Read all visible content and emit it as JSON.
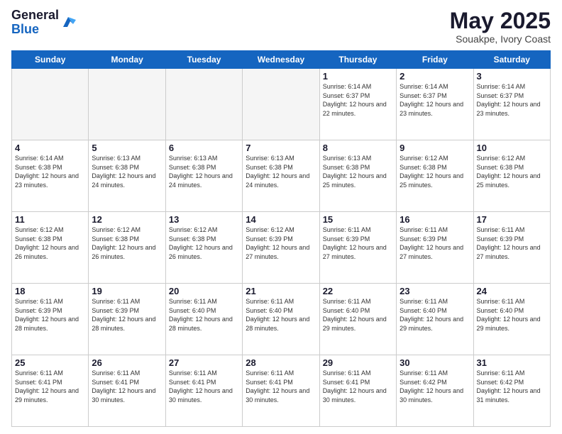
{
  "header": {
    "logo_general": "General",
    "logo_blue": "Blue",
    "month_title": "May 2025",
    "subtitle": "Souakpe, Ivory Coast"
  },
  "days_of_week": [
    "Sunday",
    "Monday",
    "Tuesday",
    "Wednesday",
    "Thursday",
    "Friday",
    "Saturday"
  ],
  "weeks": [
    [
      {
        "day": "",
        "empty": true
      },
      {
        "day": "",
        "empty": true
      },
      {
        "day": "",
        "empty": true
      },
      {
        "day": "",
        "empty": true
      },
      {
        "day": "1",
        "sunrise": "6:14 AM",
        "sunset": "6:37 PM",
        "daylight": "12 hours and 22 minutes."
      },
      {
        "day": "2",
        "sunrise": "6:14 AM",
        "sunset": "6:37 PM",
        "daylight": "12 hours and 23 minutes."
      },
      {
        "day": "3",
        "sunrise": "6:14 AM",
        "sunset": "6:37 PM",
        "daylight": "12 hours and 23 minutes."
      }
    ],
    [
      {
        "day": "4",
        "sunrise": "6:14 AM",
        "sunset": "6:38 PM",
        "daylight": "12 hours and 23 minutes."
      },
      {
        "day": "5",
        "sunrise": "6:13 AM",
        "sunset": "6:38 PM",
        "daylight": "12 hours and 24 minutes."
      },
      {
        "day": "6",
        "sunrise": "6:13 AM",
        "sunset": "6:38 PM",
        "daylight": "12 hours and 24 minutes."
      },
      {
        "day": "7",
        "sunrise": "6:13 AM",
        "sunset": "6:38 PM",
        "daylight": "12 hours and 24 minutes."
      },
      {
        "day": "8",
        "sunrise": "6:13 AM",
        "sunset": "6:38 PM",
        "daylight": "12 hours and 25 minutes."
      },
      {
        "day": "9",
        "sunrise": "6:12 AM",
        "sunset": "6:38 PM",
        "daylight": "12 hours and 25 minutes."
      },
      {
        "day": "10",
        "sunrise": "6:12 AM",
        "sunset": "6:38 PM",
        "daylight": "12 hours and 25 minutes."
      }
    ],
    [
      {
        "day": "11",
        "sunrise": "6:12 AM",
        "sunset": "6:38 PM",
        "daylight": "12 hours and 26 minutes."
      },
      {
        "day": "12",
        "sunrise": "6:12 AM",
        "sunset": "6:38 PM",
        "daylight": "12 hours and 26 minutes."
      },
      {
        "day": "13",
        "sunrise": "6:12 AM",
        "sunset": "6:38 PM",
        "daylight": "12 hours and 26 minutes."
      },
      {
        "day": "14",
        "sunrise": "6:12 AM",
        "sunset": "6:39 PM",
        "daylight": "12 hours and 27 minutes."
      },
      {
        "day": "15",
        "sunrise": "6:11 AM",
        "sunset": "6:39 PM",
        "daylight": "12 hours and 27 minutes."
      },
      {
        "day": "16",
        "sunrise": "6:11 AM",
        "sunset": "6:39 PM",
        "daylight": "12 hours and 27 minutes."
      },
      {
        "day": "17",
        "sunrise": "6:11 AM",
        "sunset": "6:39 PM",
        "daylight": "12 hours and 27 minutes."
      }
    ],
    [
      {
        "day": "18",
        "sunrise": "6:11 AM",
        "sunset": "6:39 PM",
        "daylight": "12 hours and 28 minutes."
      },
      {
        "day": "19",
        "sunrise": "6:11 AM",
        "sunset": "6:39 PM",
        "daylight": "12 hours and 28 minutes."
      },
      {
        "day": "20",
        "sunrise": "6:11 AM",
        "sunset": "6:40 PM",
        "daylight": "12 hours and 28 minutes."
      },
      {
        "day": "21",
        "sunrise": "6:11 AM",
        "sunset": "6:40 PM",
        "daylight": "12 hours and 28 minutes."
      },
      {
        "day": "22",
        "sunrise": "6:11 AM",
        "sunset": "6:40 PM",
        "daylight": "12 hours and 29 minutes."
      },
      {
        "day": "23",
        "sunrise": "6:11 AM",
        "sunset": "6:40 PM",
        "daylight": "12 hours and 29 minutes."
      },
      {
        "day": "24",
        "sunrise": "6:11 AM",
        "sunset": "6:40 PM",
        "daylight": "12 hours and 29 minutes."
      }
    ],
    [
      {
        "day": "25",
        "sunrise": "6:11 AM",
        "sunset": "6:41 PM",
        "daylight": "12 hours and 29 minutes."
      },
      {
        "day": "26",
        "sunrise": "6:11 AM",
        "sunset": "6:41 PM",
        "daylight": "12 hours and 30 minutes."
      },
      {
        "day": "27",
        "sunrise": "6:11 AM",
        "sunset": "6:41 PM",
        "daylight": "12 hours and 30 minutes."
      },
      {
        "day": "28",
        "sunrise": "6:11 AM",
        "sunset": "6:41 PM",
        "daylight": "12 hours and 30 minutes."
      },
      {
        "day": "29",
        "sunrise": "6:11 AM",
        "sunset": "6:41 PM",
        "daylight": "12 hours and 30 minutes."
      },
      {
        "day": "30",
        "sunrise": "6:11 AM",
        "sunset": "6:42 PM",
        "daylight": "12 hours and 30 minutes."
      },
      {
        "day": "31",
        "sunrise": "6:11 AM",
        "sunset": "6:42 PM",
        "daylight": "12 hours and 31 minutes."
      }
    ]
  ]
}
